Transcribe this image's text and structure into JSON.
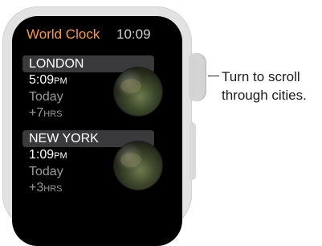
{
  "watch": {
    "app_title": "World Clock",
    "time": "10:09",
    "cities": [
      {
        "name": "LONDON",
        "time": "5:09",
        "ampm": "PM",
        "day": "Today",
        "offset": "+7",
        "offset_unit": "HRS",
        "globe_icon": "earth-globe-icon"
      },
      {
        "name": "NEW YORK",
        "time": "1:09",
        "ampm": "PM",
        "day": "Today",
        "offset": "+3",
        "offset_unit": "HRS",
        "globe_icon": "earth-globe-icon"
      }
    ]
  },
  "callout": {
    "text": "Turn to scroll\nthrough cities."
  }
}
